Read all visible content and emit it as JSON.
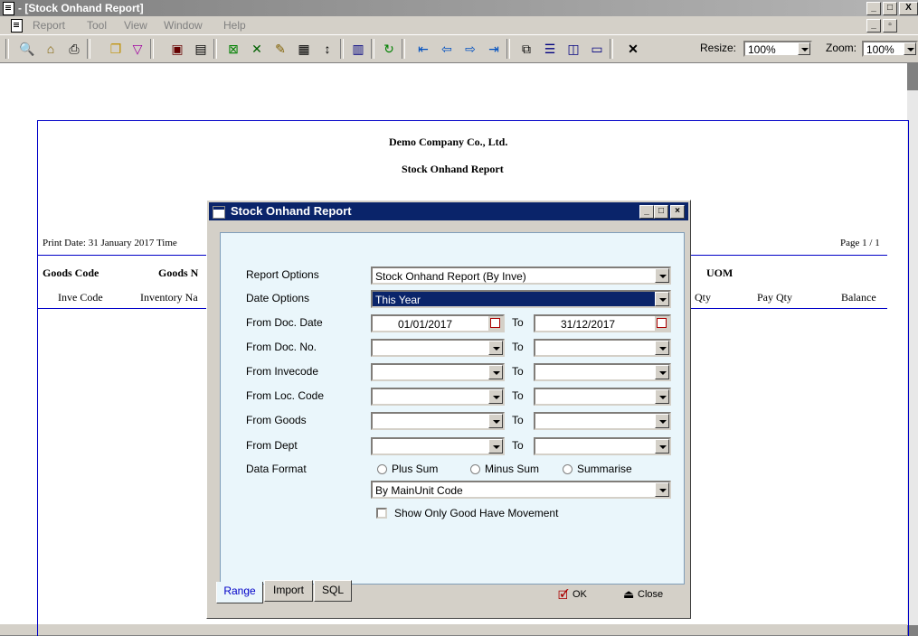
{
  "window": {
    "title": " - [Stock Onhand Report]",
    "controls": [
      "_",
      "□",
      "X"
    ]
  },
  "menu": {
    "items": [
      "Report",
      "Tool",
      "View",
      "Window",
      "Help"
    ]
  },
  "toolbar": {
    "resize_label": "Resize:",
    "resize_value": "100%",
    "zoom_label": "Zoom:",
    "zoom_value": "100%",
    "close_symbol": "✕"
  },
  "report": {
    "company": "Demo Company Co., Ltd.",
    "title": "Stock Onhand Report",
    "print_date": "Print Date: 31 January 2017  Time",
    "page": "Page 1 / 1",
    "header_row1": {
      "goods_code": "Goods Code",
      "goods_name": "Goods N",
      "uom": "UOM"
    },
    "header_row2": {
      "inve_code": "Inve Code",
      "inventory_name": "Inventory Na",
      "qty": "Qty",
      "pay_qty": "Pay Qty",
      "balance": "Balance"
    }
  },
  "dialog": {
    "title": "Stock Onhand Report",
    "report_options_label": "Report Options",
    "report_options_value": "Stock Onhand Report (By Inve)",
    "date_options_label": "Date Options",
    "date_options_value": "This Year",
    "from_doc_date_label": "From Doc. Date",
    "from_doc_date_value": "01/01/2017",
    "to_doc_date_value": "31/12/2017",
    "from_doc_no_label": "From Doc. No.",
    "from_invecode_label": "From Invecode",
    "from_loc_code_label": "From Loc. Code",
    "from_goods_label": "From Goods",
    "from_dept_label": "From Dept",
    "to_label": "To",
    "data_format_label": "Data Format",
    "plus_sum": "Plus Sum",
    "minus_sum": "Minus Sum",
    "summarise": "Summarise",
    "unit_value": "By MainUnit Code",
    "show_only_movement": "Show Only Good Have Movement",
    "tabs": [
      "Range",
      "Import",
      "SQL"
    ],
    "ok_label": "OK",
    "close_label": "Close"
  }
}
